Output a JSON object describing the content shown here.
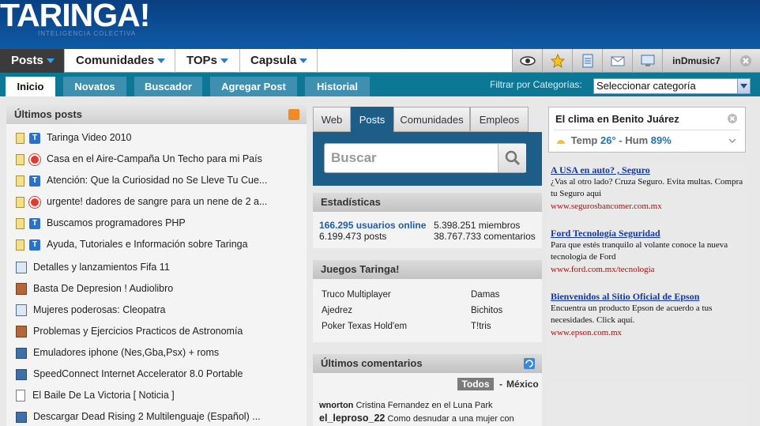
{
  "header": {
    "logo": "TARINGA!",
    "slogan": "INTELIGENCIA COLECTIVA"
  },
  "main_nav": {
    "items": [
      {
        "label": "Posts"
      },
      {
        "label": "Comunidades"
      },
      {
        "label": "TOPs"
      },
      {
        "label": "Capsula"
      }
    ],
    "icons": [
      "eye-icon",
      "star-icon",
      "document-icon",
      "mail-icon",
      "monitor-icon"
    ],
    "username": "inDmusic7"
  },
  "sub_nav": {
    "tabs": [
      "Inicio",
      "Novatos",
      "Buscador",
      "Agregar Post",
      "Historial"
    ],
    "filter_label": "Filtrar por Categorías:",
    "filter_value": "Seleccionar categoría"
  },
  "latest_posts": {
    "title": "Últimos posts",
    "items": [
      {
        "title": "Taringa Video 2010",
        "icon": "taringa-icon"
      },
      {
        "title": "Casa en el Aire-Campaña Un Techo para mi País",
        "icon": "no-entry-icon"
      },
      {
        "title": "Atención: Que la Curiosidad no Se Lleve Tu Cue...",
        "icon": "taringa-icon"
      },
      {
        "title": "urgente! dadores de sangre para un nene de 2 a...",
        "icon": "no-entry-icon"
      },
      {
        "title": "Buscamos programadores PHP",
        "icon": "taringa-icon"
      },
      {
        "title": "Ayuda, Tutoriales e Información sobre Taringa",
        "icon": "taringa-icon"
      },
      {
        "title": "Detalles y lanzamientos Fifa 11",
        "icon": "book-icon"
      },
      {
        "title": "Basta De Depresion ! Audiolibro",
        "icon": "brown-book-icon"
      },
      {
        "title": "Mujeres poderosas: Cleopatra",
        "icon": "book-icon"
      },
      {
        "title": "Problemas y Ejercicios Practicos de Astronomía",
        "icon": "brown-book-icon"
      },
      {
        "title": "Emuladores iphone (Nes,Gba,Psx) + roms",
        "icon": "floppy-icon"
      },
      {
        "title": "SpeedConnect Internet Accelerator 8.0 Portable",
        "icon": "floppy-icon"
      },
      {
        "title": "El Baile De La Victoria [ Noticia ]",
        "icon": "document-icon"
      },
      {
        "title": "Descargar Dead Rising 2 Multilenguaje (Español) ...",
        "icon": "floppy-icon"
      }
    ]
  },
  "search": {
    "tabs": [
      "Web",
      "Posts",
      "Comunidades",
      "Empleos"
    ],
    "placeholder": "Buscar"
  },
  "stats": {
    "title": "Estadísticas",
    "online": "166.295 usuarios online",
    "members": "5.398.251 miembros",
    "posts": "6.199.473 posts",
    "comments": "38.767.733 comentarios"
  },
  "games": {
    "title": "Juegos Taringa!",
    "left": [
      "Truco Multiplayer",
      "Ajedrez",
      "Poker Texas Hold'em"
    ],
    "right": [
      "Damas",
      "Bichitos",
      "T!tris"
    ]
  },
  "comments": {
    "title": "Últimos comentarios",
    "filter_all": "Todos",
    "filter_sep": "-",
    "filter_country": "México",
    "items": [
      {
        "user": "wnorton",
        "text": "Cristina Fernandez en el Luna Park"
      },
      {
        "user": "el_leproso_22",
        "text": "Como desnudar a una mujer con"
      }
    ]
  },
  "weather": {
    "title": "El clima en Benito Juárez",
    "temp_label": "Temp",
    "temp_value": "26°",
    "sep": "-",
    "hum_label": "Hum",
    "hum_value": "89%"
  },
  "ads": [
    {
      "title": "A USA en auto? , Seguro",
      "desc": "¿Vas al otro lado? Cruza Seguro. Evita multas. Compra tu Seguro aqui",
      "url": "www.segurosbancomer.com.mx"
    },
    {
      "title": "Ford Tecnología Seguridad",
      "desc": "Para que estés tranquilo al volante conoce la nueva tecnologia de Ford",
      "url": "www.ford.com.mx/tecnologia"
    },
    {
      "title": "Bienvenidos al Sitio Oficial de Epson",
      "desc": "Encuentra un producto Epson de acuerdo a tus necesidades. Click aquí.",
      "url": "www.epson.com.mx"
    }
  ]
}
